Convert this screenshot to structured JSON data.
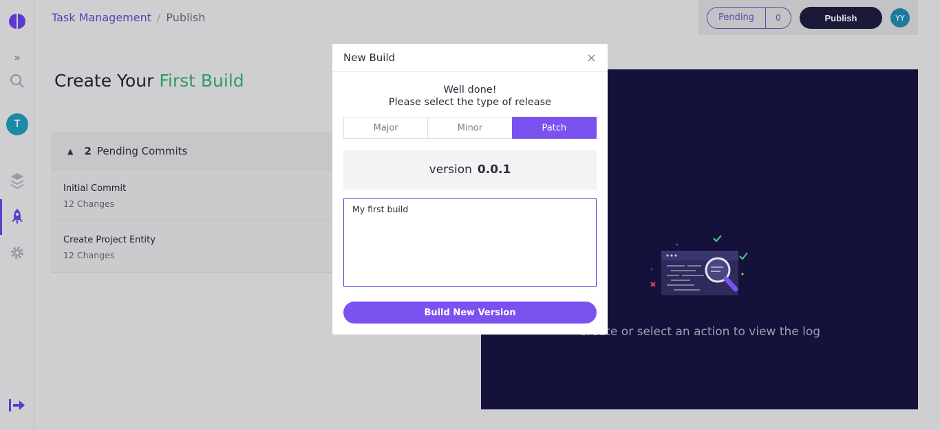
{
  "breadcrumb": {
    "parent": "Task Management",
    "separator": "/",
    "current": "Publish"
  },
  "header": {
    "pending_label": "Pending",
    "pending_count": "0",
    "publish_label": "Publish",
    "user_initials": "YY"
  },
  "sidebar": {
    "workspace_initial": "T",
    "expand_glyph": "»"
  },
  "page": {
    "title_prefix": "Create Your",
    "title_accent": "First Build"
  },
  "commits": {
    "count": "2",
    "label": "Pending Commits",
    "items": [
      {
        "title": "Initial Commit",
        "changes": "12 Changes"
      },
      {
        "title": "Create Project Entity",
        "changes": "12 Changes"
      }
    ]
  },
  "log": {
    "empty_text": "Create or select an action to view the log"
  },
  "modal": {
    "title": "New Build",
    "close_glyph": "×",
    "message_line1": "Well done!",
    "message_line2": "Please select the type of release",
    "tabs": [
      {
        "label": "Major",
        "active": false
      },
      {
        "label": "Minor",
        "active": false
      },
      {
        "label": "Patch",
        "active": true
      }
    ],
    "version_label": "version",
    "version_value": "0.0.1",
    "notes_value": "My first build",
    "build_button": "Build New Version"
  },
  "colors": {
    "accent": "#7b52f0",
    "brand": "#5c3bcf",
    "success": "#2f9a63",
    "log_bg": "#14123a"
  }
}
